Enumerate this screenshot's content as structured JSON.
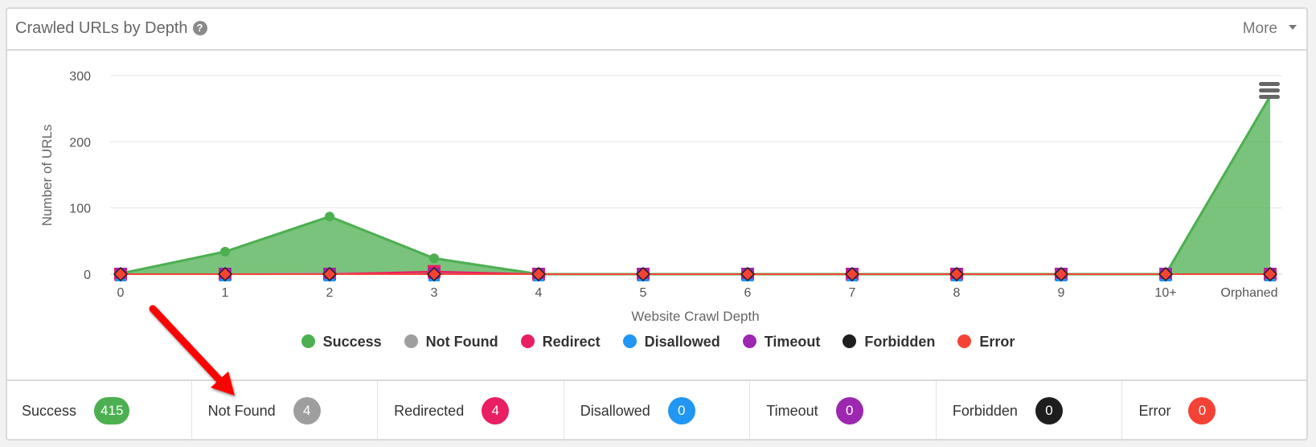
{
  "card": {
    "title": "Crawled URLs by Depth",
    "help_icon": "question-circle-icon",
    "more_label": "More"
  },
  "chart_data": {
    "type": "area",
    "title": "",
    "xlabel": "Website Crawl Depth",
    "ylabel": "Number of URLs",
    "ylim": [
      0,
      300
    ],
    "yticks": [
      0,
      100,
      200,
      300
    ],
    "grid": true,
    "legend_position": "bottom",
    "categories": [
      "0",
      "1",
      "2",
      "3",
      "4",
      "5",
      "6",
      "7",
      "8",
      "9",
      "10+",
      "Orphaned"
    ],
    "series": [
      {
        "name": "Success",
        "color": "#4caf50",
        "values": [
          1,
          34,
          87,
          24,
          0,
          0,
          0,
          0,
          0,
          0,
          0,
          269
        ]
      },
      {
        "name": "Not Found",
        "color": "#9e9e9e",
        "values": [
          0,
          0,
          2,
          2,
          0,
          0,
          0,
          0,
          0,
          0,
          0,
          0
        ]
      },
      {
        "name": "Redirect",
        "color": "#e91e63",
        "values": [
          0,
          0,
          0,
          4,
          0,
          0,
          0,
          0,
          0,
          0,
          0,
          0
        ]
      },
      {
        "name": "Disallowed",
        "color": "#2196f3",
        "values": [
          0,
          0,
          0,
          0,
          0,
          0,
          0,
          0,
          0,
          0,
          0,
          0
        ]
      },
      {
        "name": "Timeout",
        "color": "#9c27b0",
        "values": [
          0,
          0,
          0,
          0,
          0,
          0,
          0,
          0,
          0,
          0,
          0,
          0
        ]
      },
      {
        "name": "Forbidden",
        "color": "#1e1e1e",
        "values": [
          0,
          0,
          0,
          0,
          0,
          0,
          0,
          0,
          0,
          0,
          0,
          0
        ]
      },
      {
        "name": "Error",
        "color": "#f44336",
        "values": [
          0,
          0,
          0,
          0,
          0,
          0,
          0,
          0,
          0,
          0,
          0,
          0
        ]
      }
    ],
    "menu_icon": "hamburger-menu-icon"
  },
  "stats": [
    {
      "label": "Success",
      "count": "415",
      "color": "#4caf50"
    },
    {
      "label": "Not Found",
      "count": "4",
      "color": "#9e9e9e"
    },
    {
      "label": "Redirected",
      "count": "4",
      "color": "#e91e63"
    },
    {
      "label": "Disallowed",
      "count": "0",
      "color": "#2196f3"
    },
    {
      "label": "Timeout",
      "count": "0",
      "color": "#9c27b0"
    },
    {
      "label": "Forbidden",
      "count": "0",
      "color": "#1e1e1e"
    },
    {
      "label": "Error",
      "count": "0",
      "color": "#f44336"
    }
  ],
  "annotation": {
    "type": "arrow",
    "color": "#ff0000",
    "points_to": "Not Found"
  }
}
